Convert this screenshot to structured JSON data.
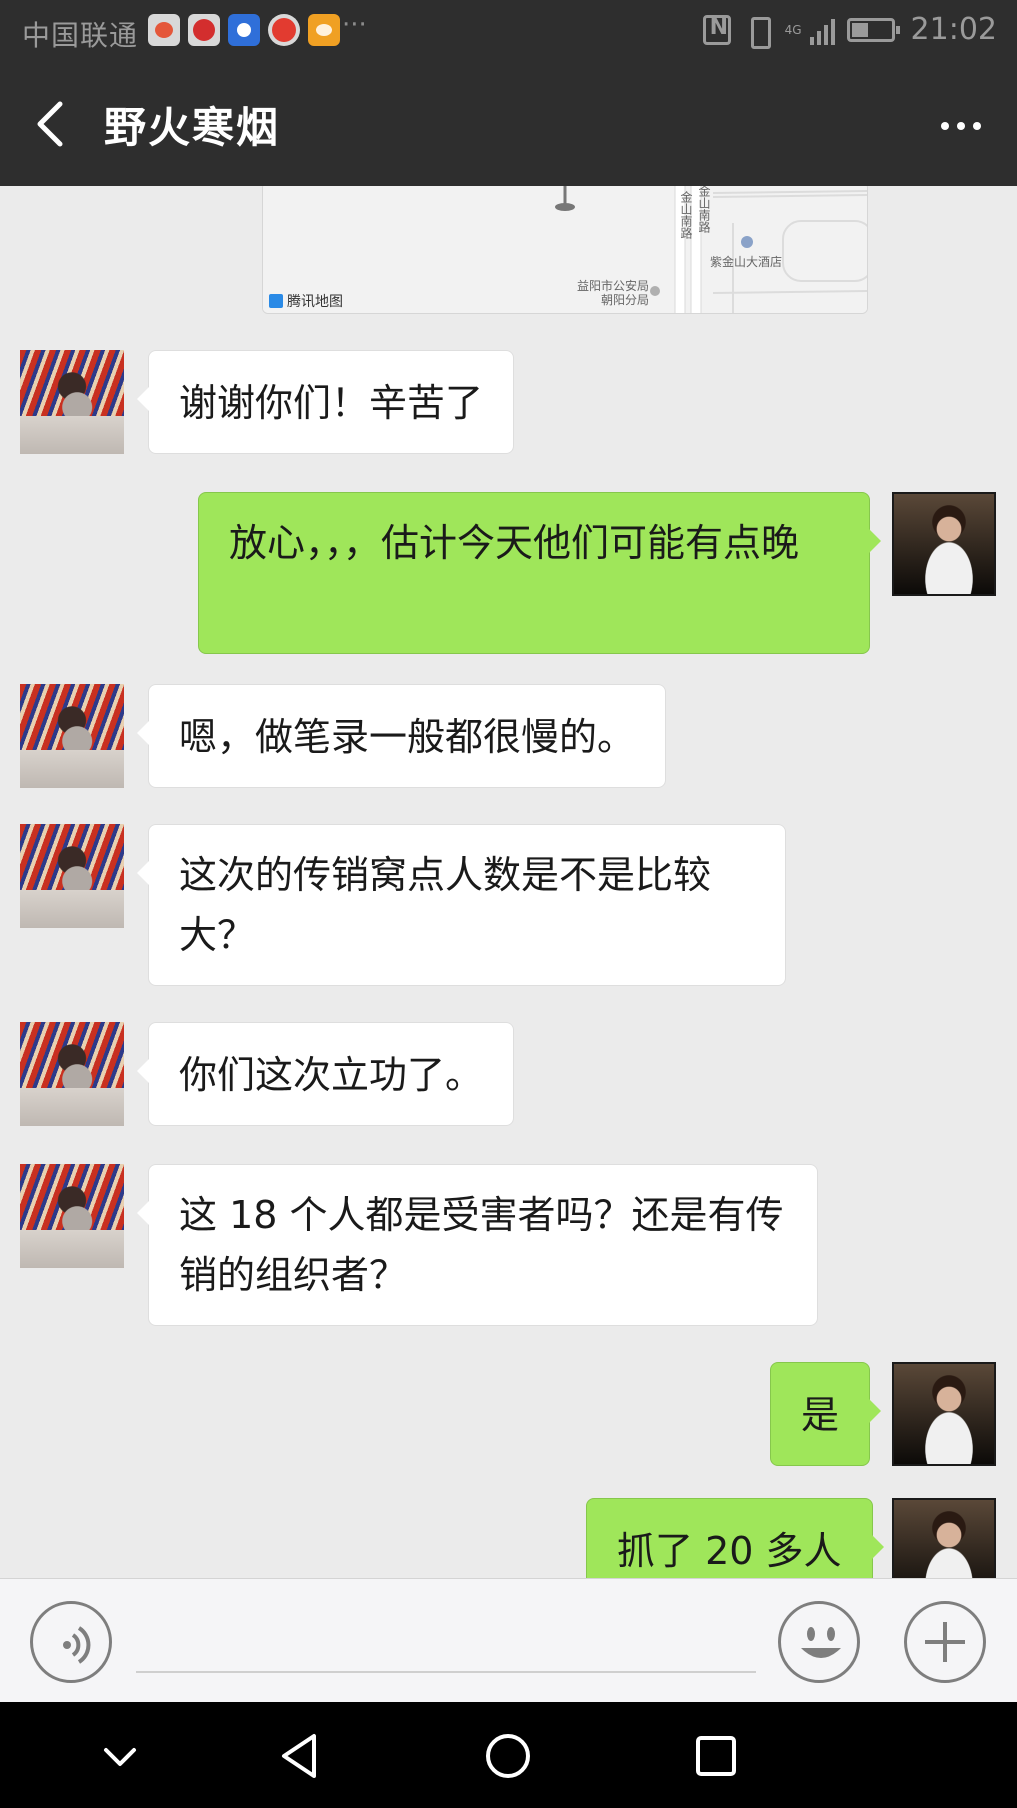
{
  "status_bar": {
    "carrier": "中国联通",
    "more_notifications": "···",
    "network_type": "4G",
    "time": "21:02"
  },
  "header": {
    "title": "野火寒烟"
  },
  "map_card": {
    "attribution": "腾讯地图",
    "labels": {
      "road_1": "金山南路",
      "road_2": "金山南路",
      "hotel": "紫金山大酒店",
      "police_1": "益阳市公安局",
      "police_2": "朝阳分局"
    }
  },
  "messages": [
    {
      "side": "left",
      "text": "谢谢你们！辛苦了"
    },
    {
      "side": "right",
      "text": "放心，，，估计今天他们可能有点晚"
    },
    {
      "side": "left",
      "text": "嗯，做笔录一般都很慢的。"
    },
    {
      "side": "left",
      "text": "这次的传销窝点人数是不是比较大？"
    },
    {
      "side": "left",
      "text": "你们这次立功了。"
    },
    {
      "side": "left",
      "text": "这 18 个人都是受害者吗？还是有传销的组织者？"
    },
    {
      "side": "right",
      "text": "是"
    },
    {
      "side": "right",
      "text": "抓了 20 多人"
    }
  ],
  "input_bar": {
    "placeholder": ""
  },
  "colors": {
    "header_bg": "#2e2e2e",
    "chat_bg": "#ebebeb",
    "outgoing_bubble": "#9fe65a",
    "incoming_bubble": "#ffffff"
  },
  "icons": {
    "back": "chevron-left-icon",
    "menu": "more-dots-icon",
    "voice": "voice-icon",
    "emoji": "emoji-icon",
    "plus": "plus-icon",
    "nav_down": "chevron-down-icon",
    "nav_back": "triangle-back-icon",
    "nav_home": "circle-home-icon",
    "nav_recent": "square-recent-icon"
  }
}
